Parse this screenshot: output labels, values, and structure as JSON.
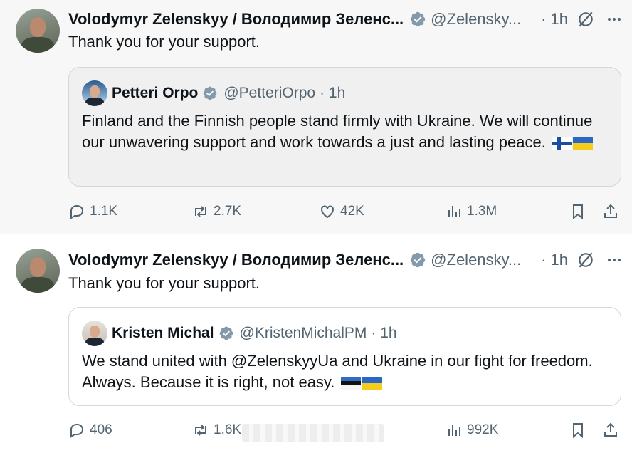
{
  "colors": {
    "text": "#0f1419",
    "muted": "#536471",
    "verified": "#829aab",
    "border": "#cfd9de"
  },
  "tweets": [
    {
      "author_name": "Volodymyr Zelenskyy / Володимир Зеленс...",
      "handle": "@Zelensky...",
      "time": "· 1h",
      "text": "Thank you for your support.",
      "quote": {
        "name": "Petteri Orpo",
        "handle": "@PetteriOrpo",
        "time": "· 1h",
        "text": "Finland and the Finnish people stand firmly with Ukraine. We will continue our unwavering support and work towards a just and lasting peace.",
        "flags": [
          "finland-flag",
          "ukraine-flag"
        ]
      },
      "actions": {
        "replies": "1.1K",
        "reposts": "2.7K",
        "likes": "42K",
        "views": "1.3M"
      }
    },
    {
      "author_name": "Volodymyr Zelenskyy / Володимир Зеленс...",
      "handle": "@Zelensky...",
      "time": "· 1h",
      "text": "Thank you for your support.",
      "quote": {
        "name": "Kristen Michal",
        "handle": "@KristenMichalPM",
        "time": "· 1h",
        "text": "We stand united with @ZelenskyyUa and Ukraine in our fight for freedom. Always. Because it is right, not easy.",
        "flags": [
          "estonia-flag",
          "ukraine-flag"
        ]
      },
      "actions": {
        "replies": "406",
        "reposts": "1.6K",
        "likes": "",
        "views": "992K"
      }
    }
  ],
  "icons": [
    "verified-badge-icon",
    "grok-icon",
    "more-icon",
    "reply-icon",
    "repost-icon",
    "like-icon",
    "views-icon",
    "bookmark-icon",
    "share-icon"
  ]
}
